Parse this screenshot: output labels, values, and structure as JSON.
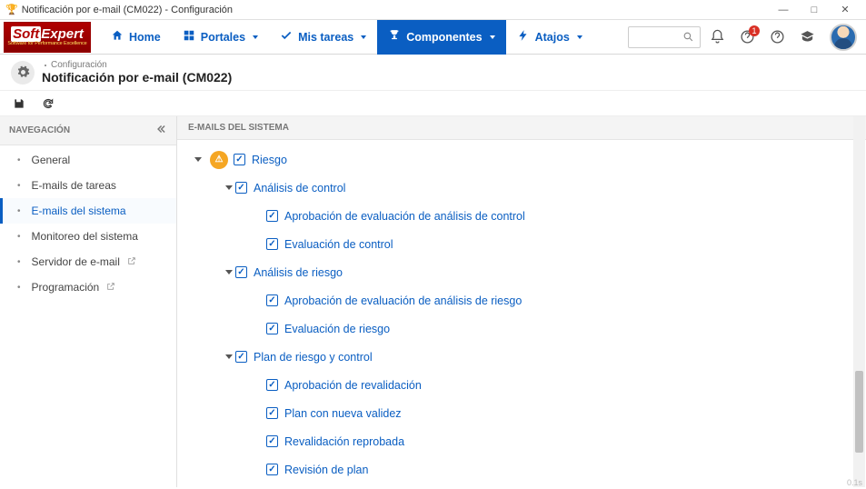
{
  "window": {
    "title": "Notificación por e-mail (CM022) - Configuración"
  },
  "nav": {
    "home": "Home",
    "portales": "Portales",
    "mistareas": "Mis tareas",
    "componentes": "Componentes",
    "atajos": "Atajos"
  },
  "breadcrumb": {
    "label": "Configuración"
  },
  "page": {
    "title": "Notificación por e-mail (CM022)"
  },
  "sidebar": {
    "header": "NAVEGACIÓN",
    "items": [
      {
        "label": "General",
        "active": false,
        "ext": false
      },
      {
        "label": "E-mails de tareas",
        "active": false,
        "ext": false
      },
      {
        "label": "E-mails del sistema",
        "active": true,
        "ext": false
      },
      {
        "label": "Monitoreo del sistema",
        "active": false,
        "ext": false
      },
      {
        "label": "Servidor de e-mail",
        "active": false,
        "ext": true
      },
      {
        "label": "Programación",
        "active": false,
        "ext": true
      }
    ]
  },
  "main": {
    "header": "E-MAILS DEL SISTEMA",
    "tree": {
      "root": {
        "label": "Riesgo"
      },
      "n1": [
        {
          "label": "Análisis de control",
          "children": [
            "Aprobación de evaluación de análisis de control",
            "Evaluación de control"
          ]
        },
        {
          "label": "Análisis de riesgo",
          "children": [
            "Aprobación de evaluación de análisis de riesgo",
            "Evaluación de riesgo"
          ]
        },
        {
          "label": "Plan de riesgo y control",
          "children": [
            "Aprobación de revalidación",
            "Plan con nueva validez",
            "Revalidación reprobada",
            "Revisión de plan"
          ]
        }
      ]
    }
  },
  "help_badge": "1",
  "version": "0.1s"
}
